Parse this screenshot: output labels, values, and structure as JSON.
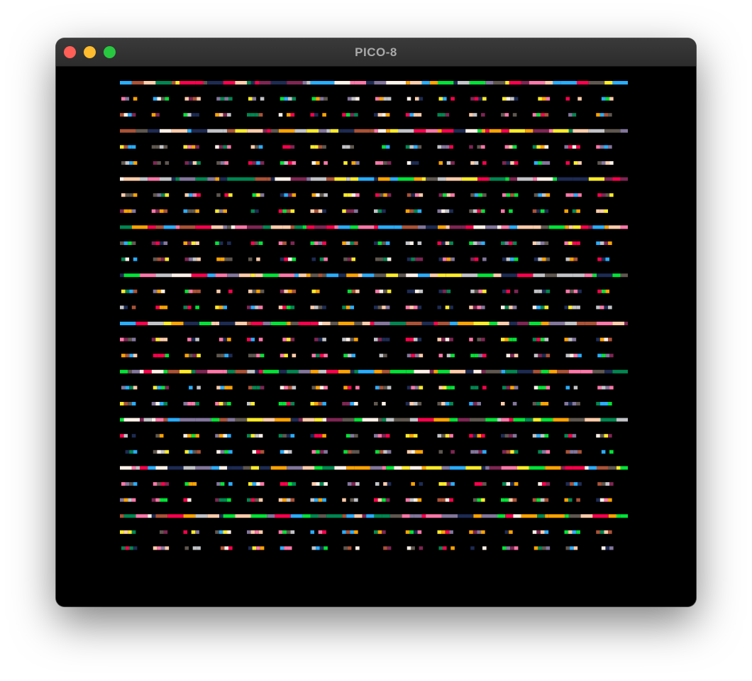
{
  "window": {
    "title": "PICO-8"
  },
  "screen": {
    "description_colors": {
      "background": "#000000"
    },
    "palette": [
      "#ff004d",
      "#ffa300",
      "#ffec27",
      "#00e436",
      "#29adff",
      "#83769c",
      "#ff77a8",
      "#ffccaa",
      "#fff1e8",
      "#c2c3c7",
      "#5f574f",
      "#7e2553",
      "#1d2b53",
      "#008751",
      "#ab5236"
    ],
    "pattern": {
      "groups": 10,
      "rows_per_group": 3,
      "segments_per_row": 16,
      "pixels_per_segment": 4
    }
  }
}
